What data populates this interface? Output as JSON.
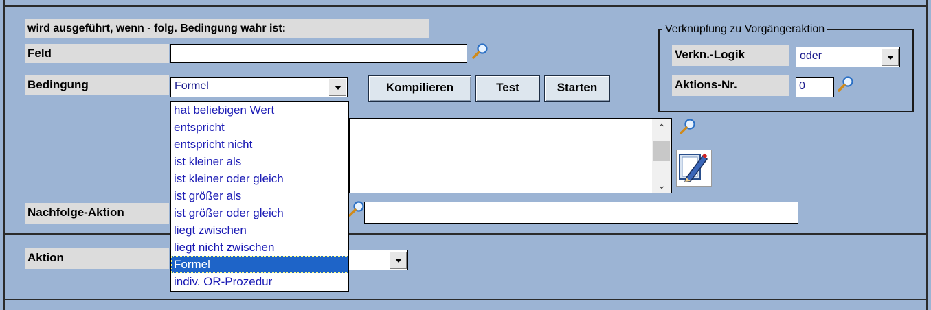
{
  "header": {
    "condition_caption": "wird ausgeführt, wenn  - folg. Bedingung wahr ist:"
  },
  "feld": {
    "label": "Feld",
    "value": ""
  },
  "bedingung": {
    "label": "Bedingung",
    "selected": "Formel",
    "options": [
      "hat beliebigen Wert",
      "entspricht",
      "entspricht nicht",
      "ist kleiner als",
      "ist kleiner oder gleich",
      "ist größer als",
      "ist größer oder gleich",
      "liegt zwischen",
      "liegt nicht zwischen",
      "Formel",
      "indiv. OR-Prozedur"
    ]
  },
  "buttons": {
    "kompilieren": "Kompilieren",
    "test": "Test",
    "starten": "Starten"
  },
  "verknuepfung": {
    "title": "Verknüpfung zu Vorgängeraktion",
    "logik_label": "Verkn.-Logik",
    "logik_value": "oder",
    "aktions_nr_label": "Aktions-Nr.",
    "aktions_nr_value": "0"
  },
  "nachfolge": {
    "label": "Nachfolge-Aktion",
    "value": ""
  },
  "aktion": {
    "label": "Aktion",
    "value": ""
  },
  "icons": {
    "magnifier": "magnifier-icon",
    "pencil": "pencil-icon",
    "dropdown": "chevron-down-icon"
  },
  "colors": {
    "background": "#9cb4d4",
    "selection": "#1e64c8",
    "option_text": "#1a1ab4"
  }
}
